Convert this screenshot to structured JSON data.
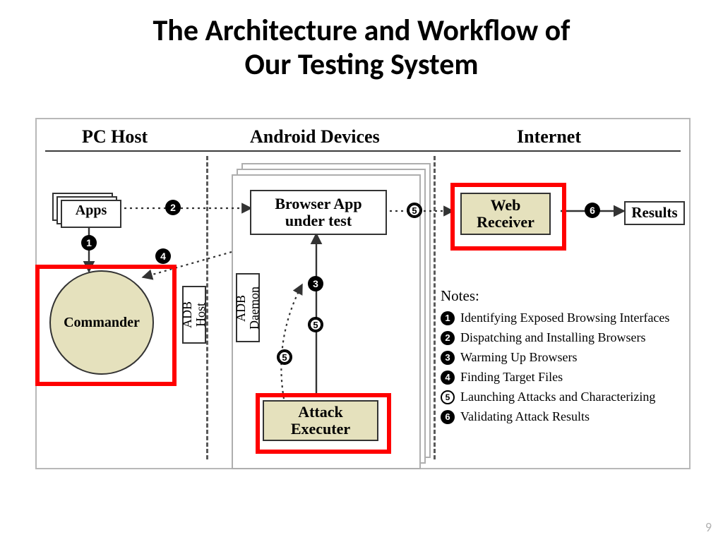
{
  "title_line1": "The Architecture and Workflow of",
  "title_line2": "Our Testing System",
  "regions": {
    "pc": "PC Host",
    "android": "Android Devices",
    "internet": "Internet"
  },
  "components": {
    "apps": "Apps",
    "commander": "Commander",
    "adb_host": "ADB\nHost",
    "adb_daemon": "ADB\nDaemon",
    "browser": "Browser App\nunder test",
    "attack": "Attack\nExecuter",
    "web_receiver": "Web\nReceiver",
    "results": "Results"
  },
  "badges": {
    "one": "1",
    "two": "2",
    "three": "3",
    "four": "4",
    "five": "5",
    "six": "6"
  },
  "notes_heading": "Notes:",
  "notes": [
    {
      "n": "1",
      "style": "black",
      "text": "Identifying Exposed Browsing Interfaces"
    },
    {
      "n": "2",
      "style": "black",
      "text": "Dispatching and Installing Browsers"
    },
    {
      "n": "3",
      "style": "black",
      "text": "Warming Up Browsers"
    },
    {
      "n": "4",
      "style": "black",
      "text": "Finding Target Files"
    },
    {
      "n": "5",
      "style": "white",
      "text": "Launching Attacks and Characterizing"
    },
    {
      "n": "6",
      "style": "black",
      "text": "Validating Attack Results"
    }
  ],
  "page_number": "9"
}
